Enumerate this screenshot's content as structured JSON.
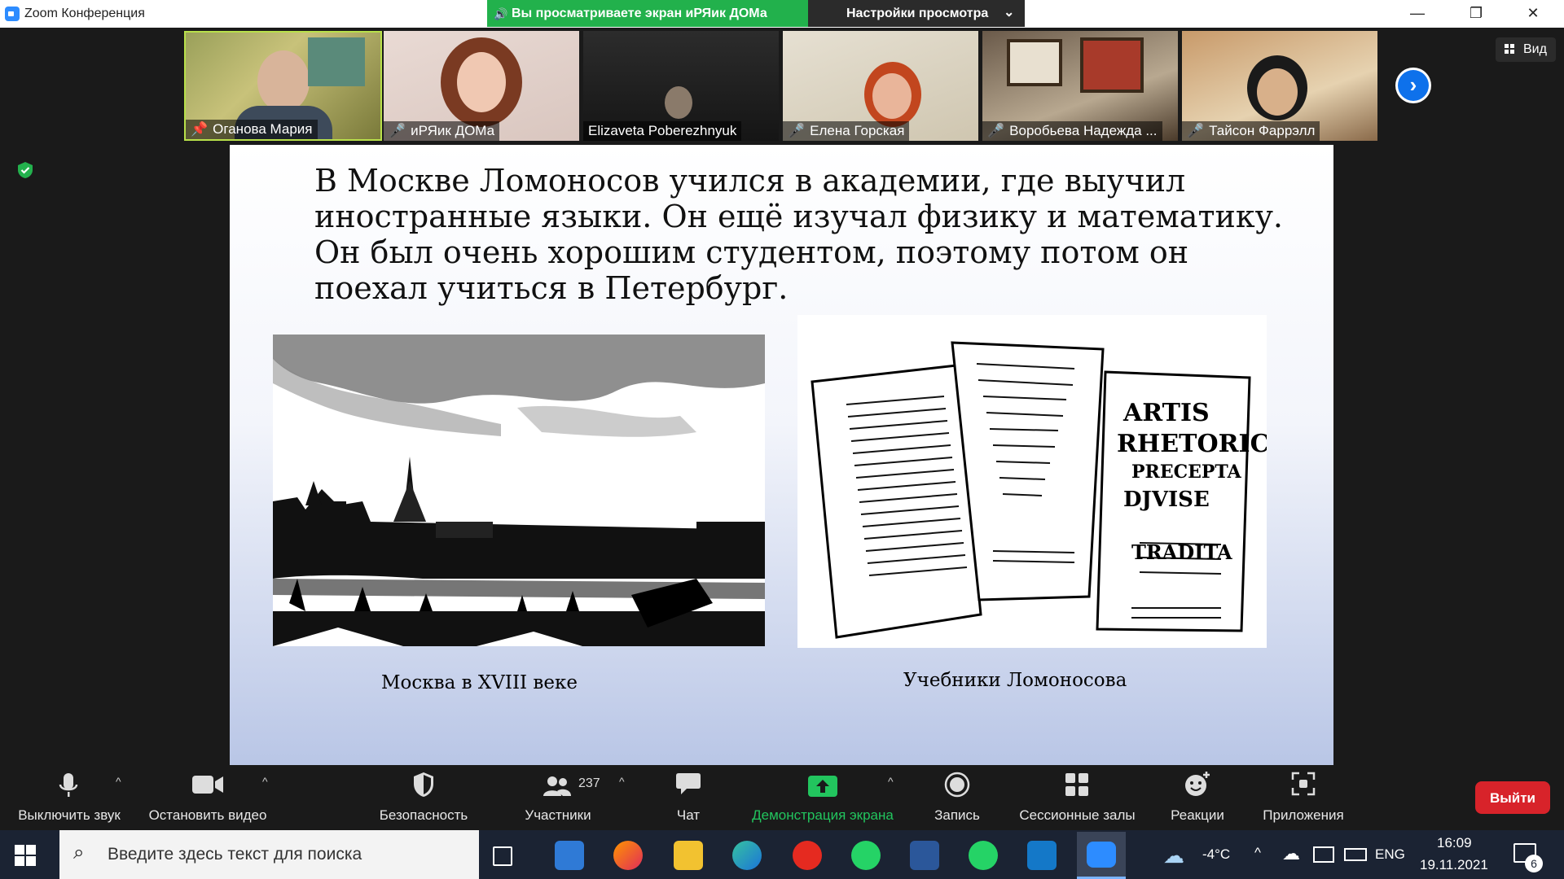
{
  "window": {
    "title": "Zoom Конференция",
    "share_banner": "Вы просматриваете экран иРЯик ДОМа",
    "view_settings": "Настройки просмотра",
    "minimize": "—",
    "maximize": "❐",
    "close": "✕"
  },
  "gallery": {
    "view_label": "Вид",
    "participants": [
      {
        "name": "Оганова Мария",
        "icon": "pin-icon"
      },
      {
        "name": "иРЯик ДОМа",
        "icon": "mic-muted-icon"
      },
      {
        "name": "Elizaveta Poberezhnyuk",
        "icon": ""
      },
      {
        "name": "Елена Горская",
        "icon": "mic-muted-icon"
      },
      {
        "name": "Воробьева Надежда ...",
        "icon": "mic-muted-icon"
      },
      {
        "name": "Тайсон Фаррэлл",
        "icon": "mic-muted-icon"
      }
    ]
  },
  "slide": {
    "text": "В Москве Ломоносов учился в академии, где выучил иностранные языки. Он ещё изучал физику и математику. Он был очень хорошим студентом, поэтому потом он поехал учиться в Петербург.",
    "caption_left": "Москва в XVIII веке",
    "caption_right": "Учебники Ломоносова",
    "book_left_title": "ARTIS RHETORICA PRAECEPTA",
    "book_right_text": "ARTIS RHETORICA PRECEPTA DJVISE TRADITA"
  },
  "toolbar": {
    "mute": "Выключить звук",
    "stop_video": "Остановить видео",
    "security": "Безопасность",
    "participants": "Участники",
    "participants_count": "237",
    "chat": "Чат",
    "share_screen": "Демонстрация экрана",
    "record": "Запись",
    "breakout": "Сессионные залы",
    "reactions": "Реакции",
    "apps": "Приложения",
    "leave": "Выйти"
  },
  "taskbar": {
    "search_placeholder": "Введите здесь текст для поиска",
    "weather": "-4°C",
    "language": "ENG",
    "time": "16:09",
    "date": "19.11.2021",
    "notifications": "6"
  },
  "colors": {
    "zoom_blue": "#2d8cff",
    "share_green": "#22b14c",
    "leave_red": "#d8232a"
  }
}
